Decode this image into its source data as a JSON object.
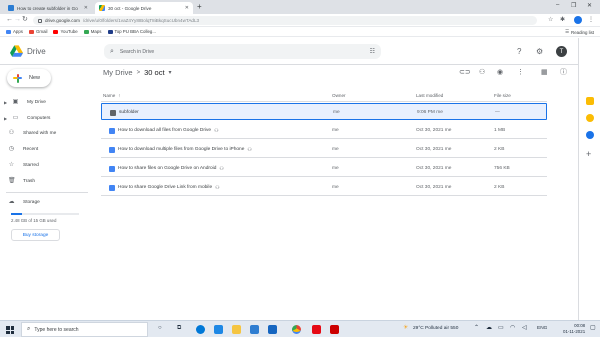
{
  "browser": {
    "tabs": [
      {
        "title": "How to create subfolder in Go",
        "active": false
      },
      {
        "title": "30 oct - Google Drive",
        "active": true
      }
    ],
    "new_tab": "+",
    "window_controls": [
      "–",
      "❐",
      "✕"
    ],
    "url_host": "drive.google.com",
    "url_path": "/drive/u/0/folders/1vaZ4Yy8IBolqT8iBkqSucUbn4wTAdL3",
    "bookmarks": [
      "Apps",
      "Gmail",
      "YouTube",
      "Maps",
      "Top PU BBA Colleg..."
    ],
    "reading_list": "Reading list",
    "profile_initial": "T"
  },
  "drive": {
    "app_name": "Drive",
    "search_placeholder": "Search in Drive",
    "new_label": "New",
    "avatar_initial": "T",
    "nav": [
      {
        "label": "My Drive",
        "icon": "my-drive-icon",
        "glyph": "▣",
        "caret": true
      },
      {
        "label": "Computers",
        "icon": "computer-icon",
        "glyph": "▭",
        "caret": true
      },
      {
        "label": "Shared with me",
        "icon": "people-icon",
        "glyph": "⚇",
        "caret": false
      },
      {
        "label": "Recent",
        "icon": "clock-icon",
        "glyph": "◷",
        "caret": false
      },
      {
        "label": "Starred",
        "icon": "star-icon",
        "glyph": "☆",
        "caret": false
      },
      {
        "label": "Trash",
        "icon": "trash-icon",
        "glyph": "🗑",
        "caret": false
      }
    ],
    "storage": {
      "label": "Storage",
      "used_text": "2.48 GB of 15 GB used",
      "used_fraction": 0.165,
      "buy_label": "Buy storage"
    },
    "breadcrumb": {
      "root": "My Drive",
      "separator": ">",
      "current": "30 oct"
    },
    "columns": {
      "name": "Name",
      "sort_indicator": "↑",
      "owner": "Owner",
      "last_modified": "Last modified",
      "file_size": "File size"
    },
    "files": [
      {
        "name": "subfolder",
        "type": "folder",
        "shared": false,
        "owner": "me",
        "modified": "9:06 PM  me",
        "size": "—"
      },
      {
        "name": "How to download all files from Google Drive",
        "type": "doc",
        "shared": true,
        "owner": "me",
        "modified": "Oct 30, 2021  me",
        "size": "1 MB"
      },
      {
        "name": "How to download multiple files from Google Drive to iPhone",
        "type": "doc",
        "shared": true,
        "owner": "me",
        "modified": "Oct 30, 2021  me",
        "size": "2 KB"
      },
      {
        "name": "How to share files on Google Drive on Android",
        "type": "doc",
        "shared": true,
        "owner": "me",
        "modified": "Oct 30, 2021  me",
        "size": "756 KB"
      },
      {
        "name": "How to share Google Drive Link from mobile",
        "type": "doc",
        "shared": true,
        "owner": "me",
        "modified": "Oct 30, 2021  me",
        "size": "2 KB"
      }
    ],
    "shared_glyph": "⚇"
  },
  "taskbar": {
    "search_placeholder": "Type here to search",
    "weather": "29°C  Polluted air 550",
    "language": "ENG",
    "time": "00:08",
    "date": "01-11-2021"
  },
  "colors": {
    "brand_blue": "#1a73e8",
    "selected_row_bg": "#e8f0fe",
    "doc_blue": "#4285f4"
  }
}
